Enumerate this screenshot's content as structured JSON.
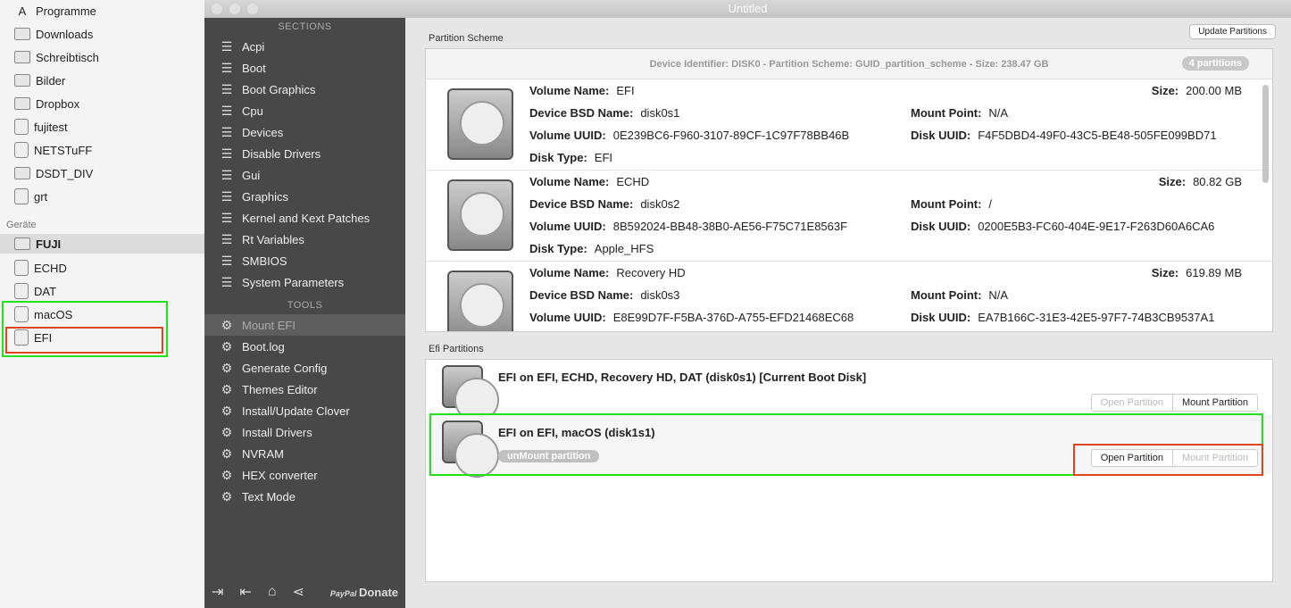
{
  "finder": {
    "favorites": [
      "Programme",
      "Downloads",
      "Schreibtisch",
      "Bilder",
      "Dropbox",
      "fujitest",
      "NETSTuFF",
      "DSDT_DIV",
      "grt"
    ],
    "devices_header": "Geräte",
    "devices": [
      "FUJI",
      "ECHD",
      "DAT",
      "macOS",
      "EFI"
    ]
  },
  "window": {
    "title": "Untitled"
  },
  "sidebar": {
    "sections_header": "SECTIONS",
    "sections": [
      "Acpi",
      "Boot",
      "Boot Graphics",
      "Cpu",
      "Devices",
      "Disable Drivers",
      "Gui",
      "Graphics",
      "Kernel and Kext Patches",
      "Rt Variables",
      "SMBIOS",
      "System Parameters"
    ],
    "tools_header": "TOOLS",
    "tools": [
      "Mount EFI",
      "Boot.log",
      "Generate Config",
      "Themes Editor",
      "Install/Update Clover",
      "Install Drivers",
      "NVRAM",
      "HEX converter",
      "Text Mode"
    ],
    "donate": "Donate"
  },
  "main": {
    "partition_scheme_label": "Partition Scheme",
    "update_button": "Update Partitions",
    "device_header": "Device Identifier: DISK0 - Partition Scheme: GUID_partition_scheme - Size: 238.47 GB",
    "partition_count": "4 partitions",
    "labels": {
      "volume_name": "Volume Name:",
      "bsd": "Device BSD Name:",
      "vuuid": "Volume UUID:",
      "dtype": "Disk Type:",
      "size": "Size:",
      "mount": "Mount Point:",
      "duuid": "Disk UUID:"
    },
    "partitions": [
      {
        "volume_name": "EFI",
        "bsd": "disk0s1",
        "vuuid": "0E239BC6-F960-3107-89CF-1C97F78BB46B",
        "dtype": "EFI",
        "size": "200.00 MB",
        "mount": "N/A",
        "duuid": "F4F5DBD4-49F0-43C5-BE48-505FE099BD71"
      },
      {
        "volume_name": "ECHD",
        "bsd": "disk0s2",
        "vuuid": "8B592024-BB48-38B0-AE56-F75C71E8563F",
        "dtype": "Apple_HFS",
        "size": "80.82 GB",
        "mount": "/",
        "duuid": "0200E5B3-FC60-404E-9E17-F263D60A6CA6"
      },
      {
        "volume_name": "Recovery HD",
        "bsd": "disk0s3",
        "vuuid": "E8E99D7F-F5BA-376D-A755-EFD21468EC68",
        "size": "619.89 MB",
        "mount": "N/A",
        "duuid": "EA7B166C-31E3-42E5-97F7-74B3CB9537A1"
      }
    ],
    "efi_label": "Efi Partitions",
    "efi": [
      {
        "title": "EFI on EFI, ECHD, Recovery HD, DAT (disk0s1) [Current Boot Disk]",
        "open": "Open Partition",
        "mount": "Mount Partition"
      },
      {
        "title": "EFI on EFI, macOS (disk1s1)",
        "status": "unMount partition",
        "open": "Open Partition",
        "mount": "Mount Partition"
      }
    ]
  },
  "colors": {
    "green": "#22e01a",
    "red": "#e0441a"
  }
}
